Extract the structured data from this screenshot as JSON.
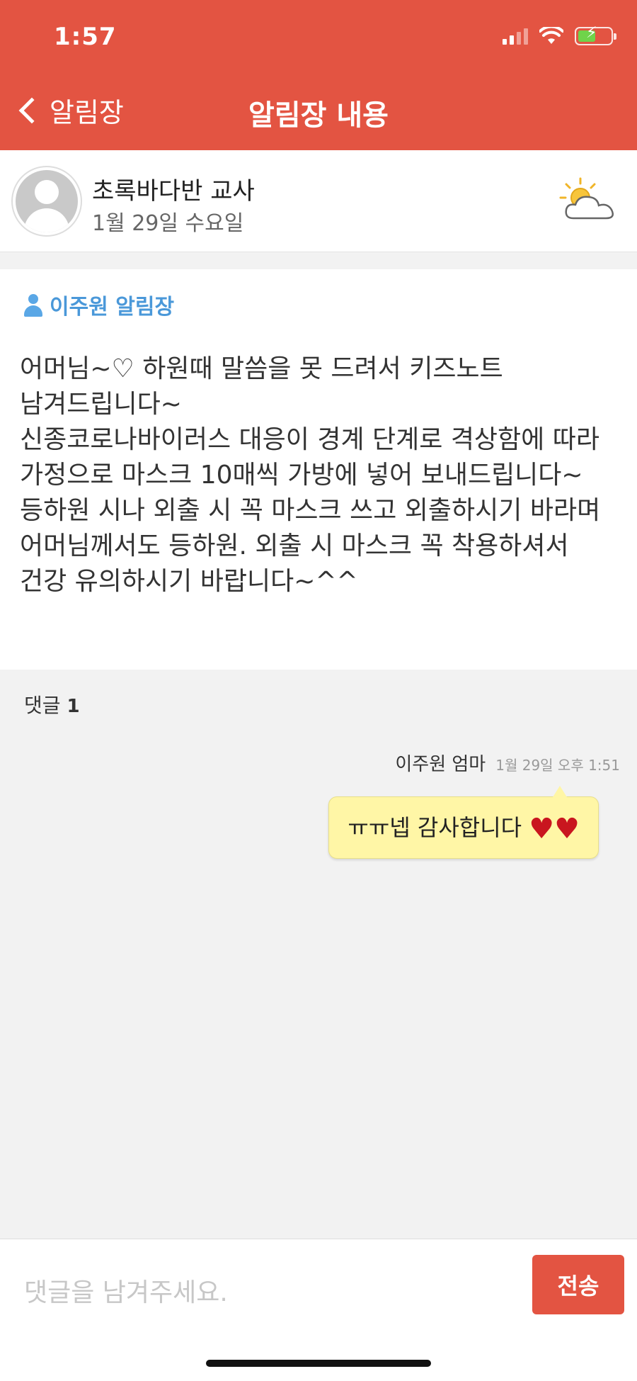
{
  "status_bar": {
    "time": "1:57",
    "icons": [
      "signal-icon",
      "wifi-icon",
      "battery-charging-icon"
    ]
  },
  "nav": {
    "back_label": "알림장",
    "title": "알림장 내용"
  },
  "teacher": {
    "name": "초록바다반 교사",
    "date": "1월 29일 수요일",
    "weather_icon": "partly-cloudy-icon"
  },
  "notice": {
    "owner": "이주원 알림장",
    "body": "어머님~♡ 하원때 말씀을 못 드려서 키즈노트 남겨드립니다~\n신종코로나바이러스 대응이 경계 단계로 격상함에 따라 가정으로 마스크 10매씩 가방에 넣어 보내드립니다~ 등하원 시나 외출 시 꼭 마스크 쓰고 외출하시기 바라며 어머님께서도 등하원. 외출 시 마스크 꼭 착용하셔서 건강 유의하시기 바랍니다~^^"
  },
  "comments": {
    "label": "댓글",
    "count": "1",
    "items": [
      {
        "author": "이주원 엄마",
        "time": "1월 29일 오후 1:51",
        "text": "ㅠㅠ넵 감사합니다 ",
        "emoji": "♥♥"
      }
    ]
  },
  "input": {
    "placeholder": "댓글을 남겨주세요.",
    "value": "",
    "send_label": "전송"
  },
  "colors": {
    "header": "#e35442",
    "accent_blue": "#4a98d9",
    "bubble": "#fff6a6",
    "send_button": "#e35442"
  }
}
